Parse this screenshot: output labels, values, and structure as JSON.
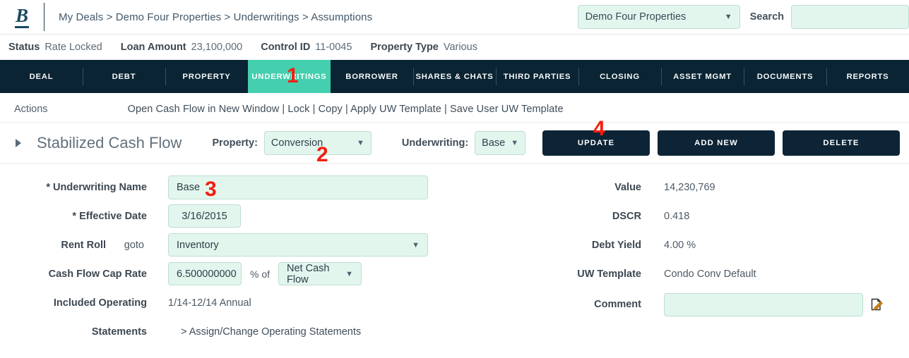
{
  "header": {
    "logo_text": "B",
    "breadcrumb": "My Deals > Demo Four Properties > Underwritings > Assumptions",
    "deal_selector_value": "Demo Four Properties",
    "search_label": "Search",
    "search_value": "",
    "search_placeholder": ""
  },
  "status_bar": [
    {
      "label": "Status",
      "value": "Rate Locked"
    },
    {
      "label": "Loan Amount",
      "value": "23,100,000"
    },
    {
      "label": "Control ID",
      "value": "11-0045"
    },
    {
      "label": "Property Type",
      "value": "Various"
    }
  ],
  "nav_tabs": [
    {
      "label": "DEAL",
      "active": false
    },
    {
      "label": "DEBT",
      "active": false
    },
    {
      "label": "PROPERTY",
      "active": false
    },
    {
      "label": "UNDERWRITINGS",
      "active": true
    },
    {
      "label": "BORROWER",
      "active": false
    },
    {
      "label": "SHARES & CHATS",
      "active": false
    },
    {
      "label": "THIRD PARTIES",
      "active": false
    },
    {
      "label": "CLOSING",
      "active": false
    },
    {
      "label": "ASSET MGMT",
      "active": false
    },
    {
      "label": "DOCUMENTS",
      "active": false
    },
    {
      "label": "REPORTS",
      "active": false
    }
  ],
  "actions": {
    "label": "Actions",
    "links_text": "Open Cash Flow in New Window | Lock | Copy |  Apply UW Template |  Save User UW Template",
    "items": [
      "Open Cash Flow in New Window",
      "Lock",
      "Copy",
      "Apply UW Template",
      "Save User UW Template"
    ]
  },
  "section": {
    "title": "Stabilized Cash Flow",
    "expand_state": "collapsed",
    "property_label": "Property:",
    "property_value": "Conversion",
    "underwriting_label": "Underwriting:",
    "underwriting_value": "Base",
    "buttons": {
      "update": "UPDATE",
      "add_new": "ADD NEW",
      "delete": "DELETE"
    }
  },
  "form_left": {
    "underwriting_name": {
      "label": "* Underwriting Name",
      "value": "Base"
    },
    "effective_date": {
      "label": "* Effective Date",
      "value": "3/16/2015"
    },
    "rent_roll": {
      "label": "Rent Roll",
      "goto": "goto",
      "value": "Inventory"
    },
    "cap_rate": {
      "label": "Cash Flow Cap Rate",
      "value": "6.500000000",
      "unit": "% of",
      "basis": "Net Cash Flow"
    },
    "included_operating": {
      "label_line1": "Included Operating",
      "label_line2": "Statements",
      "value": "1/14-12/14 Annual",
      "link": "> Assign/Change Operating Statements"
    }
  },
  "panel_right": {
    "value": {
      "label": "Value",
      "value": "14,230,769"
    },
    "dscr": {
      "label": "DSCR",
      "value": "0.418"
    },
    "debt_yield": {
      "label": "Debt Yield",
      "value": "4.00 %"
    },
    "uw_template": {
      "label": "UW Template",
      "value": "Condo Conv Default"
    },
    "comment": {
      "label": "Comment",
      "value": "",
      "placeholder": ""
    }
  },
  "annotations": [
    {
      "number": "1",
      "target": "underwritings-tab"
    },
    {
      "number": "2",
      "target": "property-dropdown"
    },
    {
      "number": "3",
      "target": "underwriting-name-input"
    },
    {
      "number": "4",
      "target": "update-button"
    }
  ],
  "colors": {
    "navy": "#0a2433",
    "teal_accent": "#44cfae",
    "mint_field": "#e3f6ee",
    "mint_border": "#bcdfd1",
    "annotation_red": "#f41e11",
    "button_dark": "#0d2436"
  }
}
